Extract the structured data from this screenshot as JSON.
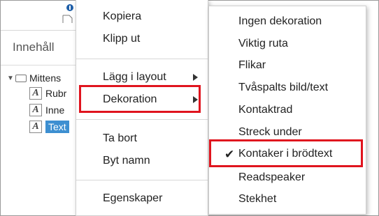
{
  "background": {
    "header_title": "Innehåll",
    "tree": {
      "root_label": "Mittens",
      "children": [
        "Rubr",
        "Inne",
        "Text"
      ],
      "icon_letter": "A"
    }
  },
  "context_menu": {
    "items": [
      {
        "label": "Kopiera"
      },
      {
        "label": "Klipp ut"
      },
      {
        "label": "Lägg i layout"
      },
      {
        "label": "Dekoration"
      },
      {
        "label": "Ta bort"
      },
      {
        "label": "Byt namn"
      },
      {
        "label": "Egenskaper"
      }
    ]
  },
  "submenu": {
    "items": [
      {
        "label": "Ingen dekoration"
      },
      {
        "label": "Viktig ruta"
      },
      {
        "label": "Flikar"
      },
      {
        "label": "Tvåspalts bild/text"
      },
      {
        "label": "Kontaktrad"
      },
      {
        "label": "Streck under"
      },
      {
        "label": "Kontaker i brödtext"
      },
      {
        "label": "Readspeaker"
      },
      {
        "label": "Stekhet"
      }
    ],
    "checked_index": 6,
    "check_glyph": "✔"
  },
  "colors": {
    "highlight_border": "#e0141e",
    "selection": "#3d8fd1"
  }
}
